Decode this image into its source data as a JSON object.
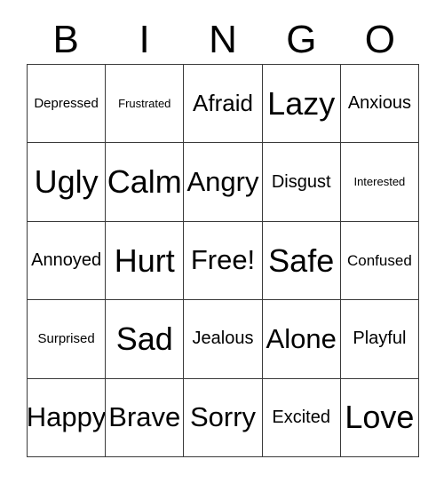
{
  "card": {
    "title": "BINGO",
    "columns": [
      "B",
      "I",
      "N",
      "G",
      "O"
    ],
    "border_color": "#3a3a3a",
    "text_color": "#000000",
    "background_color": "#ffffff",
    "rows": [
      [
        "Depressed",
        "Frustrated",
        "Afraid",
        "Lazy",
        "Anxious"
      ],
      [
        "Ugly",
        "Calm",
        "Angry",
        "Disgust",
        "Interested"
      ],
      [
        "Annoyed",
        "Hurt",
        "Free!",
        "Safe",
        "Confused"
      ],
      [
        "Surprised",
        "Sad",
        "Jealous",
        "Alone",
        "Playful"
      ],
      [
        "Happy",
        "Brave",
        "Sorry",
        "Excited",
        "Love"
      ]
    ],
    "free_space": {
      "row": 2,
      "column": 2,
      "label": "Free!"
    }
  }
}
